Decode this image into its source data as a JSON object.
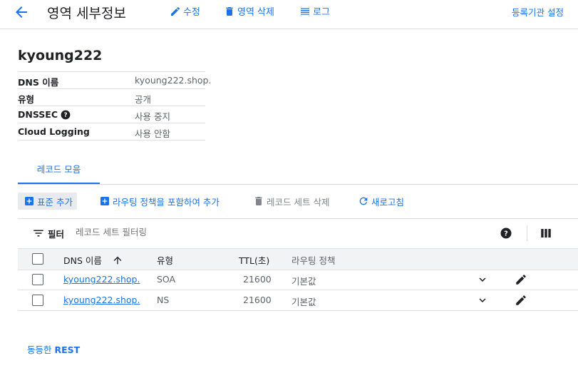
{
  "header": {
    "title": "영역 세부정보",
    "edit_label": "수정",
    "delete_zone_label": "영역 삭제",
    "logs_label": "로그",
    "registrar_label": "등록기관 설정"
  },
  "zone": {
    "name": "kyoung222",
    "details": [
      {
        "key": "DNS 이름",
        "value": "kyoung222.shop."
      },
      {
        "key": "유형",
        "value": "공개"
      },
      {
        "key": "DNSSEC",
        "value": "사용 중지"
      },
      {
        "key": "Cloud Logging",
        "value": "사용 안함"
      }
    ]
  },
  "tabs": [
    {
      "label": "레코드 모음"
    }
  ],
  "actions": {
    "add_standard": "표준 추가",
    "add_with_routing": "라우팅 정책을 포함하여 추가",
    "delete_record_set": "레코드 세트 삭제",
    "refresh": "새로고침"
  },
  "filter": {
    "label": "필터",
    "placeholder": "레코드 세트 필터링"
  },
  "table": {
    "columns": [
      "DNS 이름",
      "유형",
      "TTL(초)",
      "라우팅 정책"
    ],
    "rows": [
      {
        "name": "kyoung222.shop.",
        "type": "SOA",
        "ttl": "21600",
        "routing": "기본값"
      },
      {
        "name": "kyoung222.shop.",
        "type": "NS",
        "ttl": "21600",
        "routing": "기본값"
      }
    ]
  },
  "footer": {
    "rest_prefix": "동등한",
    "rest_label": "REST"
  },
  "colors": {
    "accent": "#1a73e8",
    "text": "#202124",
    "muted": "#5f6368",
    "divider": "#dadce0",
    "header_bg": "#f1f3f4"
  }
}
